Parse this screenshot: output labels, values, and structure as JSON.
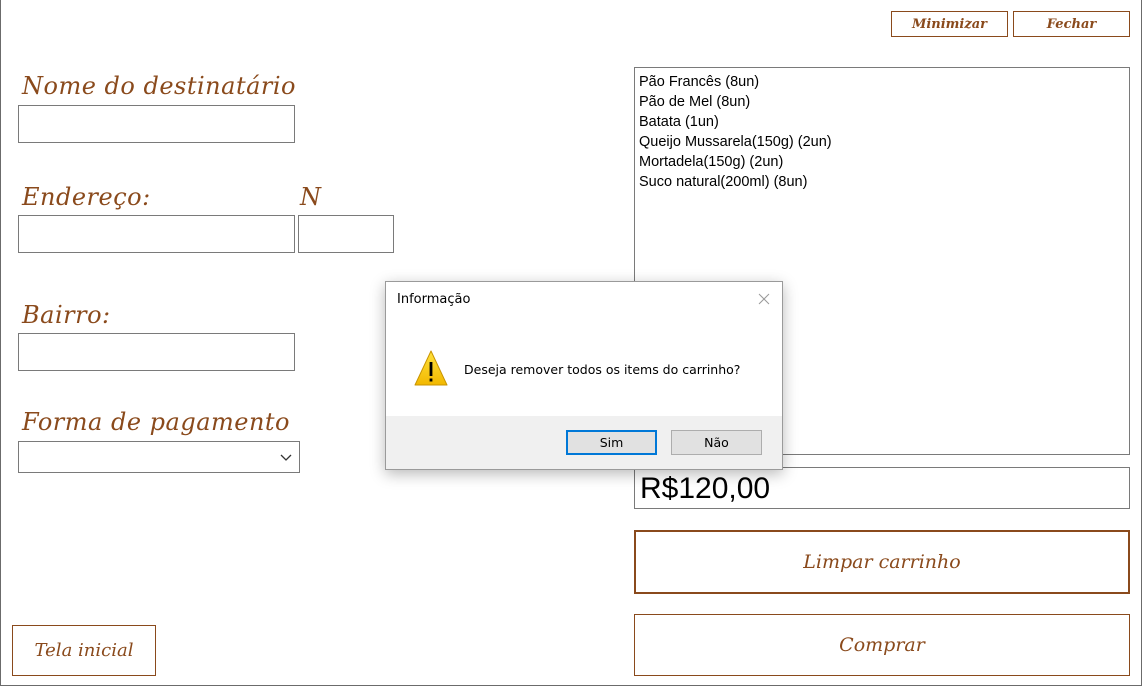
{
  "window": {
    "minimize_label": "Minimizar",
    "close_label": "Fechar"
  },
  "form": {
    "recipient_label": "Nome do destinatário",
    "recipient_value": "",
    "address_label": "Endereço:",
    "number_label": "N",
    "address_value": "",
    "number_value": "",
    "neighborhood_label": "Bairro:",
    "neighborhood_value": "",
    "payment_label": "Forma de pagamento",
    "payment_value": ""
  },
  "cart": {
    "items": [
      "Pão Francês (8un)",
      "Pão de Mel (8un)",
      "Batata (1un)",
      "Queijo Mussarela(150g) (2un)",
      "Mortadela(150g) (2un)",
      "Suco natural(200ml) (8un)"
    ],
    "total": "R$120,00",
    "clear_label": "Limpar carrinho",
    "buy_label": "Comprar"
  },
  "home_label": "Tela inicial",
  "dialog": {
    "title": "Informação",
    "message": "Deseja remover todos os items do carrinho?",
    "yes_label": "Sim",
    "no_label": "Não",
    "icon": "warning-icon"
  },
  "colors": {
    "brand": "#8a4a1c",
    "dialog_default_border": "#0078d7",
    "warning_yellow": "#f5c400"
  }
}
